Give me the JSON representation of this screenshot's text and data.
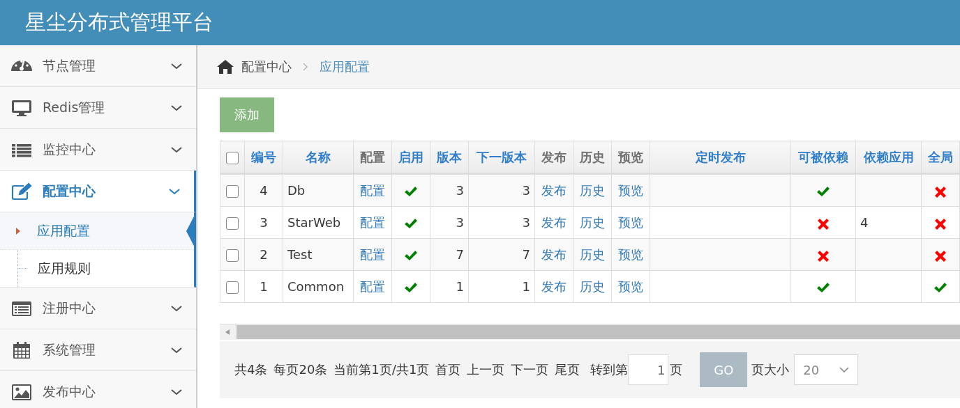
{
  "header": {
    "title": "星尘分布式管理平台"
  },
  "sidebar": {
    "items": [
      {
        "label": "节点管理",
        "selected": false
      },
      {
        "label": "Redis管理",
        "selected": false
      },
      {
        "label": "监控中心",
        "selected": false
      },
      {
        "label": "配置中心",
        "selected": true,
        "children": [
          {
            "label": "应用配置",
            "selected": true
          },
          {
            "label": "应用规则",
            "selected": false
          }
        ]
      },
      {
        "label": "注册中心",
        "selected": false
      },
      {
        "label": "系统管理",
        "selected": false
      },
      {
        "label": "发布中心",
        "selected": false
      }
    ]
  },
  "breadcrumb": [
    "配置中心",
    "应用配置"
  ],
  "add_button": "添加",
  "table": {
    "select_all": {
      "checked": false
    },
    "columns": [
      {
        "label": "编号",
        "sortable": true
      },
      {
        "label": "名称",
        "sortable": true
      },
      {
        "label": "配置",
        "sortable": false
      },
      {
        "label": "启用",
        "sortable": true
      },
      {
        "label": "版本",
        "sortable": true
      },
      {
        "label": "下一版本",
        "sortable": true
      },
      {
        "label": "发布",
        "sortable": false
      },
      {
        "label": "历史",
        "sortable": false
      },
      {
        "label": "预览",
        "sortable": false
      },
      {
        "label": "定时发布",
        "sortable": true
      },
      {
        "label": "可被依赖",
        "sortable": true
      },
      {
        "label": "依赖应用",
        "sortable": true
      },
      {
        "label": "全局",
        "sortable": true
      }
    ],
    "rows": [
      {
        "checked": false,
        "id": "4",
        "name": "Db",
        "config": "配置",
        "enabled": true,
        "version": "3",
        "next_version": "3",
        "publish": "发布",
        "history": "历史",
        "preview": "预览",
        "dependable": true,
        "global": false
      },
      {
        "checked": false,
        "id": "3",
        "name": "StarWeb",
        "config": "配置",
        "enabled": true,
        "version": "3",
        "next_version": "3",
        "publish": "发布",
        "history": "历史",
        "preview": "预览",
        "dependable": false,
        "depends_on": "4",
        "global": false
      },
      {
        "checked": false,
        "id": "2",
        "name": "Test",
        "config": "配置",
        "enabled": true,
        "version": "7",
        "next_version": "7",
        "publish": "发布",
        "history": "历史",
        "preview": "预览",
        "dependable": false,
        "global": false
      },
      {
        "checked": false,
        "id": "1",
        "name": "Common",
        "config": "配置",
        "enabled": true,
        "version": "1",
        "next_version": "1",
        "publish": "发布",
        "history": "历史",
        "preview": "预览",
        "dependable": true,
        "global": true
      }
    ]
  },
  "pager": {
    "total": "共4条",
    "per_page": "每页20条",
    "current": "当前第1页/共1页",
    "links": [
      "首页",
      "上一页",
      "下一页",
      "尾页"
    ],
    "goto_label": "转到第",
    "goto_value": "1",
    "goto_suffix": "页",
    "go_button": "GO",
    "size_label": "页大小",
    "size_value": "20"
  }
}
